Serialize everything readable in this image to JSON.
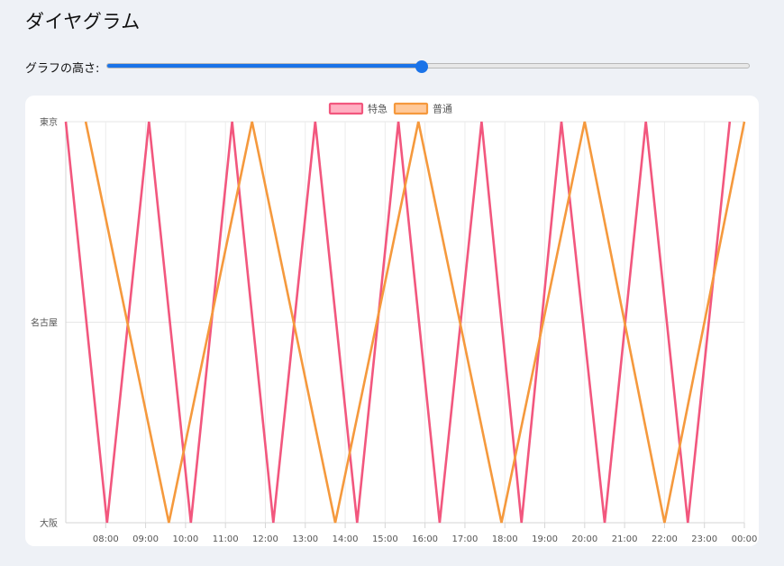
{
  "title": "ダイヤグラム",
  "controls": {
    "slider_label": "グラフの高さ:",
    "slider_value_percent": 49
  },
  "chart_data": {
    "type": "line",
    "y_categories": [
      "東京",
      "名古屋",
      "大阪"
    ],
    "x_ticks": [
      "08:00",
      "09:00",
      "10:00",
      "11:00",
      "12:00",
      "13:00",
      "14:00",
      "15:00",
      "16:00",
      "17:00",
      "18:00",
      "19:00",
      "20:00",
      "21:00",
      "22:00",
      "23:00",
      "00:00"
    ],
    "xlim": [
      "07:00",
      "24:00"
    ],
    "legend_position": "top",
    "grid": true,
    "series": [
      {
        "name": "特急",
        "color": "#f2577e",
        "fill": "#ffb0c2",
        "points": [
          {
            "x": "07:00",
            "y": "東京"
          },
          {
            "x": "08:02",
            "y": "大阪"
          },
          {
            "x": "09:05",
            "y": "東京"
          },
          {
            "x": "10:08",
            "y": "大阪"
          },
          {
            "x": "11:10",
            "y": "東京"
          },
          {
            "x": "12:12",
            "y": "大阪"
          },
          {
            "x": "13:15",
            "y": "東京"
          },
          {
            "x": "14:18",
            "y": "大阪"
          },
          {
            "x": "15:20",
            "y": "東京"
          },
          {
            "x": "16:22",
            "y": "大阪"
          },
          {
            "x": "17:25",
            "y": "東京"
          },
          {
            "x": "18:25",
            "y": "大阪"
          },
          {
            "x": "19:25",
            "y": "東京"
          },
          {
            "x": "20:30",
            "y": "大阪"
          },
          {
            "x": "21:32",
            "y": "東京"
          },
          {
            "x": "22:35",
            "y": "大阪"
          },
          {
            "x": "23:38",
            "y": "東京"
          }
        ]
      },
      {
        "name": "普通",
        "color": "#f5993d",
        "fill": "#ffc99a",
        "points": [
          {
            "x": "07:30",
            "y": "東京"
          },
          {
            "x": "09:35",
            "y": "大阪"
          },
          {
            "x": "11:40",
            "y": "東京"
          },
          {
            "x": "13:45",
            "y": "大阪"
          },
          {
            "x": "15:50",
            "y": "東京"
          },
          {
            "x": "17:55",
            "y": "大阪"
          },
          {
            "x": "20:00",
            "y": "東京"
          },
          {
            "x": "22:00",
            "y": "大阪"
          },
          {
            "x": "24:00",
            "y": "東京"
          }
        ]
      }
    ]
  }
}
